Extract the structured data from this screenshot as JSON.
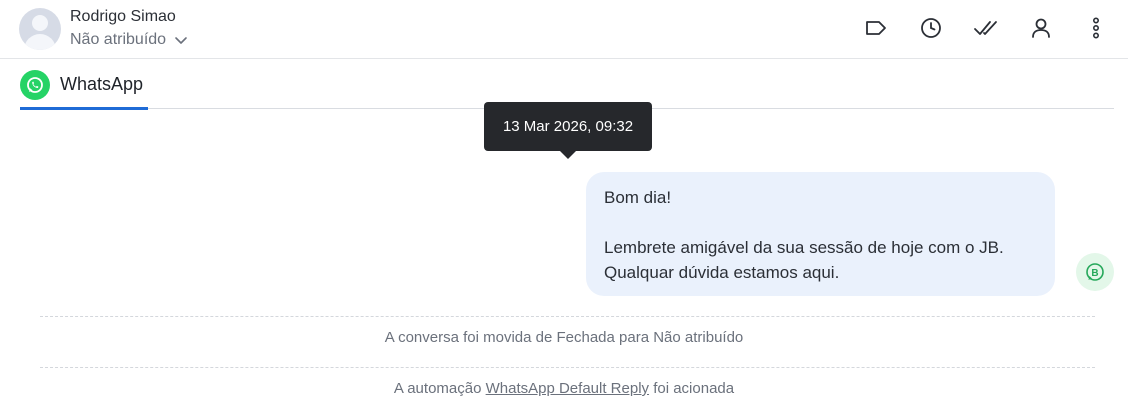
{
  "header": {
    "contact_name": "Rodrigo Simao",
    "assignee": "Não atribuído",
    "actions": [
      "label-icon",
      "snooze-icon",
      "resolve-icon",
      "assign-icon",
      "more-icon"
    ]
  },
  "tabs": [
    {
      "label": "WhatsApp",
      "icon": "whatsapp-icon",
      "active": true
    }
  ],
  "tooltip": {
    "text": "13 Mar 2026, 09:32"
  },
  "message": {
    "lines": [
      "Bom dia!",
      "Lembrete amigável da sua sessão de hoje com o JB.",
      "Qualquar dúvida estamos aqui."
    ],
    "sender_badge": "B"
  },
  "activity": [
    {
      "text": "A conversa foi movida de Fechada para Não atribuído"
    },
    {
      "prefix": "A automação ",
      "link": "WhatsApp Default Reply",
      "suffix": " foi acionada"
    }
  ],
  "colors": {
    "accent": "#1f6bd6",
    "whatsapp": "#25d366",
    "bubble": "#eaf1fc",
    "tooltip": "#26282c"
  }
}
